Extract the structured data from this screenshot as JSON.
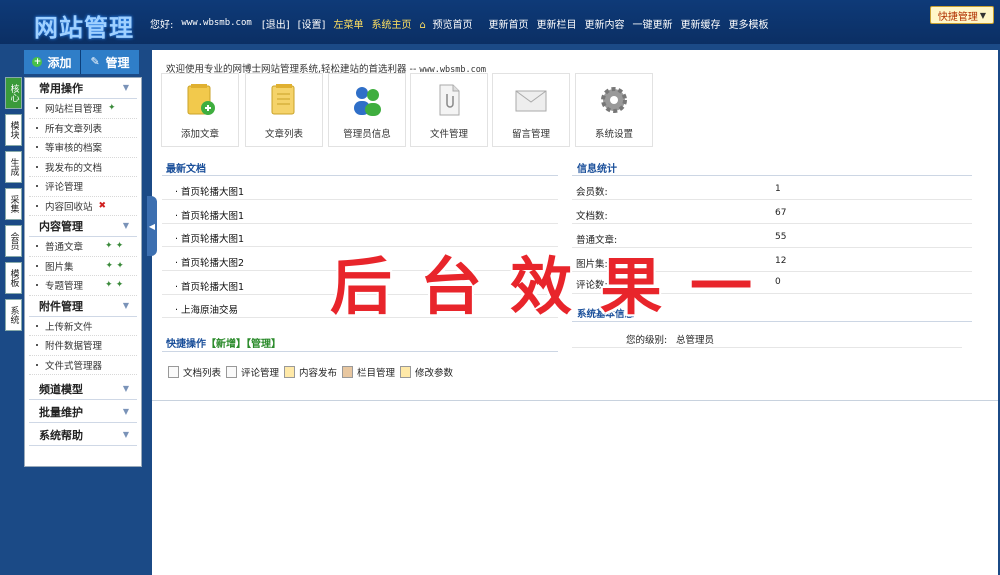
{
  "header": {
    "logo": "网站管理",
    "hello": "您好:",
    "site": "www.wbsmb.com",
    "links": [
      "[退出]",
      "[设置]"
    ],
    "nav_green": [
      "左菜单",
      "系统主页"
    ],
    "preview": "预览首页",
    "nav": [
      "更新首页",
      "更新栏目",
      "更新内容",
      "一键更新",
      "更新缓存",
      "更多模板"
    ],
    "quick": "快捷管理"
  },
  "left": {
    "add": "添加",
    "manage": "管理",
    "vtabs": [
      "核心",
      "模块",
      "生成",
      "采集",
      "会员",
      "模板",
      "系统"
    ],
    "sections": [
      {
        "title": "常用操作",
        "items": [
          "网站栏目管理",
          "所有文章列表",
          "等审核的档案",
          "我发布的文档",
          "评论管理",
          "内容回收站"
        ]
      },
      {
        "title": "内容管理",
        "items": [
          "普通文章",
          "图片集",
          "专题管理"
        ]
      },
      {
        "title": "附件管理",
        "items": [
          "上传新文件",
          "附件数据管理",
          "文件式管理器"
        ]
      },
      {
        "title": "频道模型",
        "items": []
      },
      {
        "title": "批量维护",
        "items": []
      },
      {
        "title": "系统帮助",
        "items": []
      }
    ]
  },
  "main": {
    "welcome": "欢迎使用专业的网博士网站管理系统,轻松建站的首选利器 -- ",
    "welcome_url": "www.wbsmb.com",
    "tiles": [
      "添加文章",
      "文章列表",
      "管理员信息",
      "文件管理",
      "留言管理",
      "系统设置"
    ],
    "latest_title": "最新文档",
    "articles": [
      "· 首页轮播大图1",
      "· 首页轮播大图1",
      "· 首页轮播大图1",
      "· 首页轮播大图2",
      "· 首页轮播大图1",
      "· 上海原油交易"
    ],
    "stats_title": "信息统计",
    "stats": [
      {
        "label": "会员数:",
        "value": "1"
      },
      {
        "label": "文档数:",
        "value": "67"
      },
      {
        "label": "普通文章:",
        "value": "55"
      },
      {
        "label": "图片集:",
        "value": "12"
      },
      {
        "label": "评论数:",
        "value": "0"
      }
    ],
    "sysinfo_title": "系统基本信息",
    "level_label": "您的级别:",
    "level_value": "总管理员",
    "quick_title": "快捷操作",
    "quick_add": "【新增】",
    "quick_manage": "【管理】",
    "quick_links": [
      "文档列表",
      "评论管理",
      "内容发布",
      "栏目管理",
      "修改参数"
    ],
    "overlay": "后台效果一"
  }
}
